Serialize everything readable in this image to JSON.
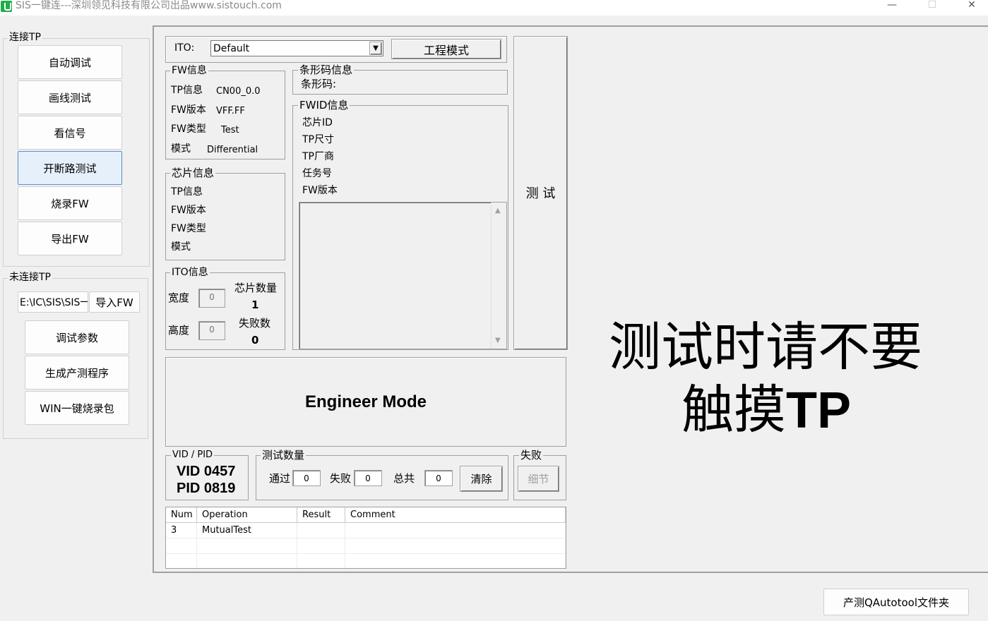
{
  "window": {
    "title": "SIS一键连---深圳领见科技有限公司出品www.sistouch.com",
    "minimize": "—",
    "maximize": "☐",
    "close": "✕"
  },
  "left": {
    "connected_group": "连接TP",
    "connected_buttons": [
      "自动调试",
      "画线测试",
      "看信号",
      "开断路测试",
      "烧录FW",
      "导出FW"
    ],
    "active_index": 3,
    "disconnected_group": "未连接TP",
    "path_value": "E:\\IC\\SIS\\SIS一",
    "import_fw": "导入FW",
    "disconnected_buttons": [
      "调试参数",
      "生成产测程序",
      "WIN一键烧录包"
    ]
  },
  "ito": {
    "label": "ITO:",
    "selected": "Default",
    "engineering_button": "工程模式"
  },
  "fw_info": {
    "title": "FW信息",
    "rows": [
      {
        "label": "TP信息",
        "value": "CN00_0.0"
      },
      {
        "label": "FW版本",
        "value": "VFF.FF"
      },
      {
        "label": "FW类型",
        "value": "Test"
      },
      {
        "label": "模式",
        "value": "Differential"
      }
    ]
  },
  "chip_info": {
    "title": "芯片信息",
    "rows": [
      "TP信息",
      "FW版本",
      "FW类型",
      "模式"
    ]
  },
  "ito_info": {
    "title": "ITO信息",
    "width_label": "宽度",
    "width_value": "0",
    "height_label": "高度",
    "height_value": "0",
    "chip_count_label": "芯片数量",
    "chip_count_value": "1",
    "fail_count_label": "失败数",
    "fail_count_value": "0"
  },
  "barcode": {
    "title": "条形码信息",
    "label": "条形码:"
  },
  "fwid": {
    "title": "FWID信息",
    "rows": [
      "芯片ID",
      "TP尺寸",
      "TP厂商",
      "任务号",
      "FW版本"
    ]
  },
  "test_button": "测 试",
  "mode_banner": "Engineer Mode",
  "vidpid": {
    "title": "VID / PID",
    "vid": "VID 0457",
    "pid": "PID 0819"
  },
  "test_count": {
    "title": "测试数量",
    "pass_label": "通过",
    "pass_value": "0",
    "fail_label": "失败",
    "fail_value": "0",
    "total_label": "总共",
    "total_value": "0",
    "clear_button": "清除"
  },
  "fail_group": {
    "title": "失败",
    "detail_button": "细节"
  },
  "table": {
    "columns": [
      "Num",
      "Operation",
      "Result",
      "Comment"
    ],
    "rows": [
      {
        "num": "3",
        "operation": "MutualTest",
        "result": "",
        "comment": ""
      }
    ]
  },
  "warning": {
    "line1": "测试时请不要",
    "line2_cn": "触摸",
    "line2_en": "TP"
  },
  "bottom_button": "产测QAutotool文件夹"
}
